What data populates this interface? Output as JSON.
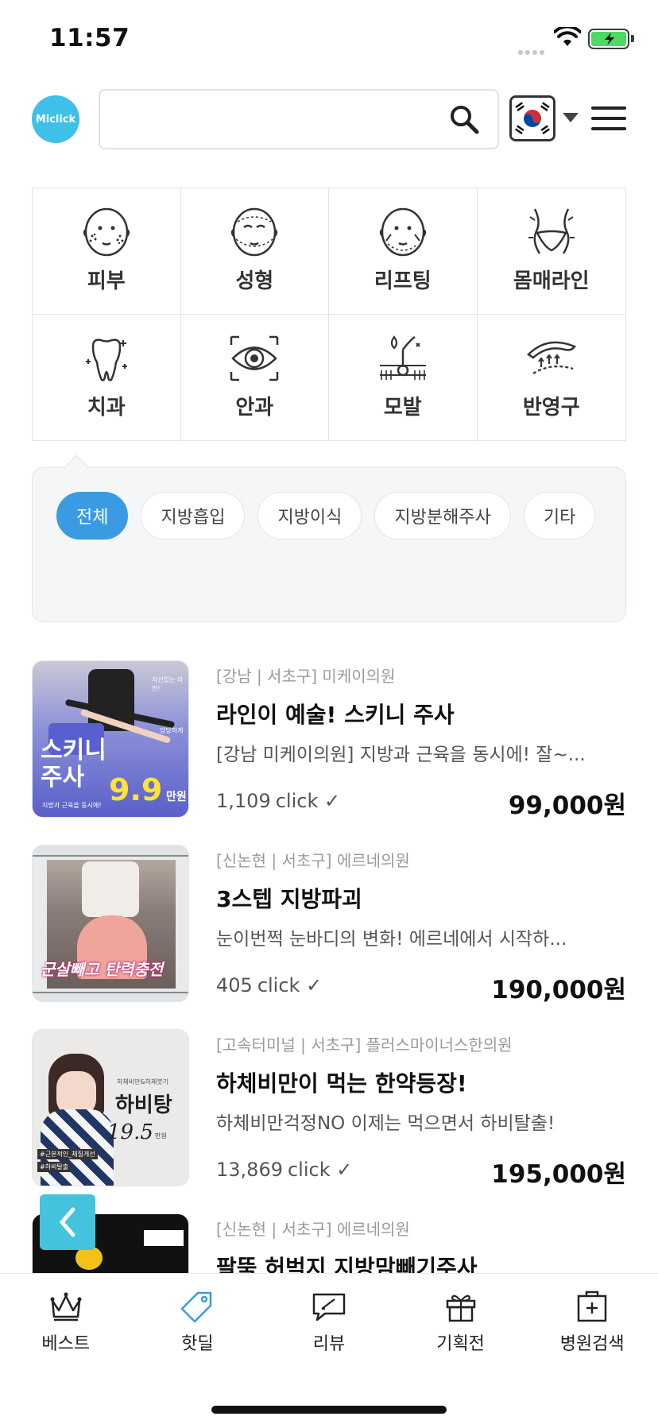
{
  "status_bar": {
    "time": "11:57"
  },
  "header": {
    "logo_text": "Miclick",
    "search_placeholder": "",
    "language_flag": "korea-flag"
  },
  "categories": [
    {
      "label": "피부",
      "icon": "face-skin-icon"
    },
    {
      "label": "성형",
      "icon": "face-surgery-icon"
    },
    {
      "label": "리프팅",
      "icon": "face-lifting-icon"
    },
    {
      "label": "몸매라인",
      "icon": "body-line-icon"
    },
    {
      "label": "치과",
      "icon": "tooth-icon"
    },
    {
      "label": "안과",
      "icon": "eye-icon"
    },
    {
      "label": "모발",
      "icon": "hair-icon"
    },
    {
      "label": "반영구",
      "icon": "eyebrow-icon"
    }
  ],
  "sub_filters": [
    {
      "label": "전체",
      "active": true
    },
    {
      "label": "지방흡입",
      "active": false
    },
    {
      "label": "지방이식",
      "active": false
    },
    {
      "label": "지방분해주사",
      "active": false
    },
    {
      "label": "기타",
      "active": false
    }
  ],
  "deals": [
    {
      "location": "[강남 | 서초구] 미케이의원",
      "title": "라인이 예술! 스키니 주사",
      "description": "[강남 미케이의원] 지방과 근육을 동시에! 잘~...",
      "clicks": "1,109",
      "click_unit": "click ✓",
      "price": "99,000원",
      "thumb": {
        "big": "스키니\n주사",
        "price": "9.9",
        "unit": "만원",
        "sub": "지방과 근육을 동시에!",
        "tag": "당당하게",
        "top": "자신있는 라인!"
      }
    },
    {
      "location": "[신논현 | 서초구] 에르네의원",
      "title": "3스텝 지방파괴",
      "description": "눈이번쩍 눈바디의 변화! 에르네에서 시작하...",
      "clicks": "405",
      "click_unit": "click ✓",
      "price": "190,000원",
      "thumb": {
        "overlay": "군살빼고 탄력충전"
      }
    },
    {
      "location": "[고속터미널 | 서초구] 플러스마이너스한의원",
      "title": "하체비만이 먹는 한약등장!",
      "description": "하체비만걱정NO 이제는 먹으면서 하비탈출!",
      "clicks": "13,869",
      "click_unit": "click ✓",
      "price": "195,000원",
      "thumb": {
        "small": "하체비만&하체붓기",
        "big": "하비탕",
        "price": "19.5",
        "unit": "만원",
        "tag1": "#근본적인_체질개선",
        "tag2": "#하비탈출"
      }
    },
    {
      "location": "[신논현 | 서초구] 에르네의원",
      "title": "팔뚝 허벅지 지방맘빼기주사",
      "description": "",
      "clicks": "",
      "click_unit": "",
      "price": ""
    }
  ],
  "bottom_nav": [
    {
      "label": "베스트",
      "icon": "crown-icon",
      "active": false
    },
    {
      "label": "핫딜",
      "icon": "tag-icon",
      "active": true
    },
    {
      "label": "리뷰",
      "icon": "review-icon",
      "active": false
    },
    {
      "label": "기획전",
      "icon": "gift-icon",
      "active": false
    },
    {
      "label": "병원검색",
      "icon": "hospital-icon",
      "active": false
    }
  ],
  "colors": {
    "accent": "#3a9be3",
    "fab": "#43c3dd",
    "logo": "#3fc0e8"
  }
}
